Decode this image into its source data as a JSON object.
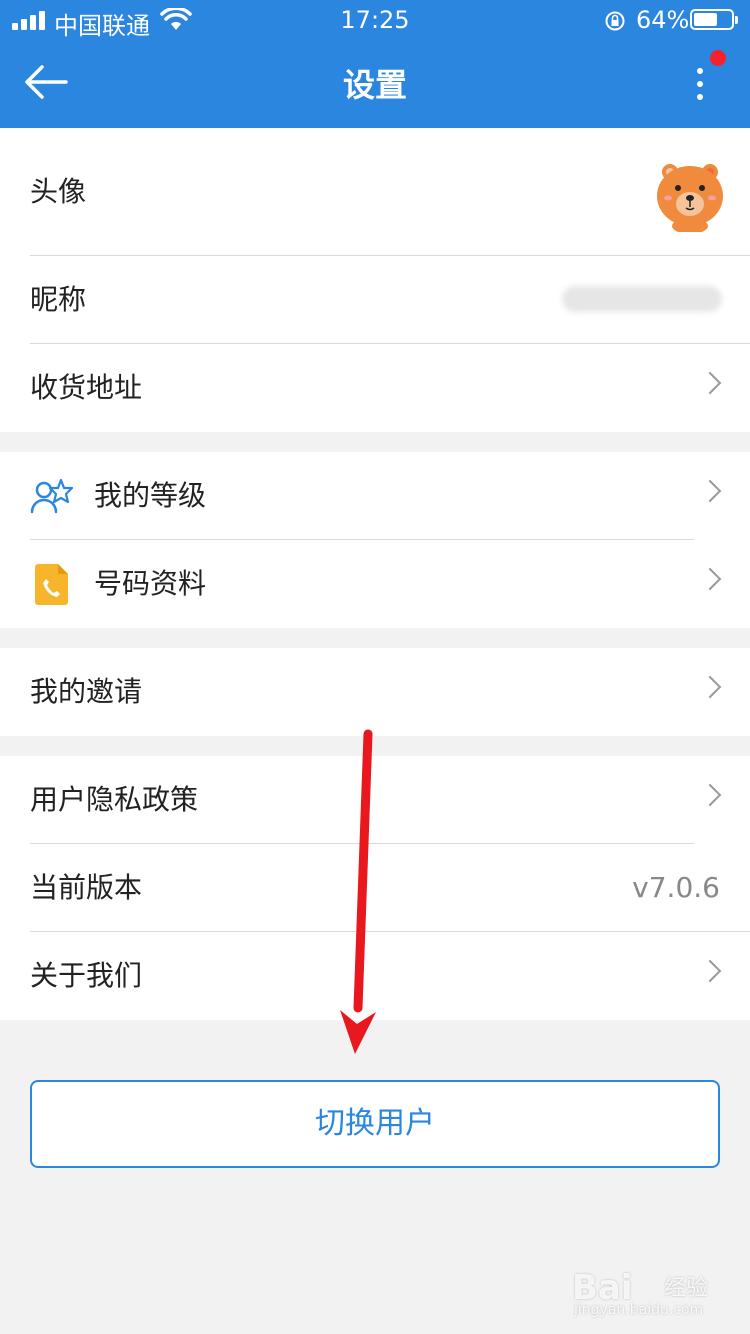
{
  "status_bar": {
    "carrier": "中国联通",
    "time": "17:25",
    "battery_percent": "64%",
    "battery_level": 0.64,
    "signal_icon": "signal-bars-icon",
    "wifi_icon": "wifi-icon",
    "rotation_lock_icon": "rotation-lock-icon"
  },
  "header": {
    "title": "设置",
    "back_icon": "back-arrow-icon",
    "more_icon": "more-vertical-icon",
    "notification_dot_color": "#f5222d",
    "background_color": "#2b86e0"
  },
  "profile_group": {
    "avatar_label": "头像",
    "avatar_icon": "bear-avatar-icon",
    "nickname_label": "昵称",
    "address_label": "收货地址"
  },
  "account_group": {
    "level_label": "我的等级",
    "level_icon": "user-star-icon",
    "number_info_label": "号码资料",
    "number_info_icon": "phone-document-icon"
  },
  "invite_group": {
    "invite_label": "我的邀请"
  },
  "about_group": {
    "privacy_label": "用户隐私政策",
    "version_label": "当前版本",
    "version_value": "v7.0.6",
    "about_label": "关于我们"
  },
  "switch_user_button": "切换用户",
  "watermark": {
    "brand": "Bai",
    "brand_suffix": "经验",
    "url": "jingyan.baidu.com"
  }
}
